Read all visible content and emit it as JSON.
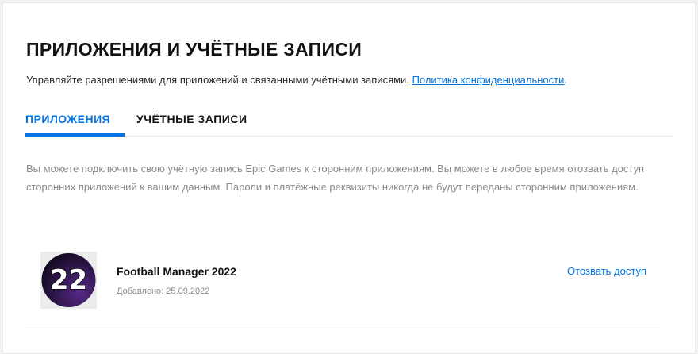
{
  "header": {
    "title": "ПРИЛОЖЕНИЯ И УЧЁТНЫЕ ЗАПИСИ",
    "subtitle": "Управляйте разрешениями для приложений и связанными учётными записями.",
    "privacy_link": "Политика конфиденциальности",
    "subtitle_end": "."
  },
  "tabs": [
    {
      "label": "ПРИЛОЖЕНИЯ",
      "active": true
    },
    {
      "label": "УЧЁТНЫЕ ЗАПИСИ",
      "active": false
    }
  ],
  "description": "Вы можете подключить свою учётную запись Epic Games к сторонним приложениям. Вы можете в любое время отозвать доступ сторонних приложений к вашим данным. Пароли и платёжные реквизиты никогда не будут переданы сторонним приложениям.",
  "apps": [
    {
      "logo_text": "22",
      "name": "Football Manager 2022",
      "added": "Добавлено: 25.09.2022",
      "revoke_label": "Отозвать доступ"
    }
  ],
  "colors": {
    "accent": "#0074e4",
    "logo_bg_dark": "#1a0f2e",
    "logo_bg_purple": "#5a2a8a"
  },
  "icons": {
    "app_logo": "football-manager-2022-logo"
  }
}
